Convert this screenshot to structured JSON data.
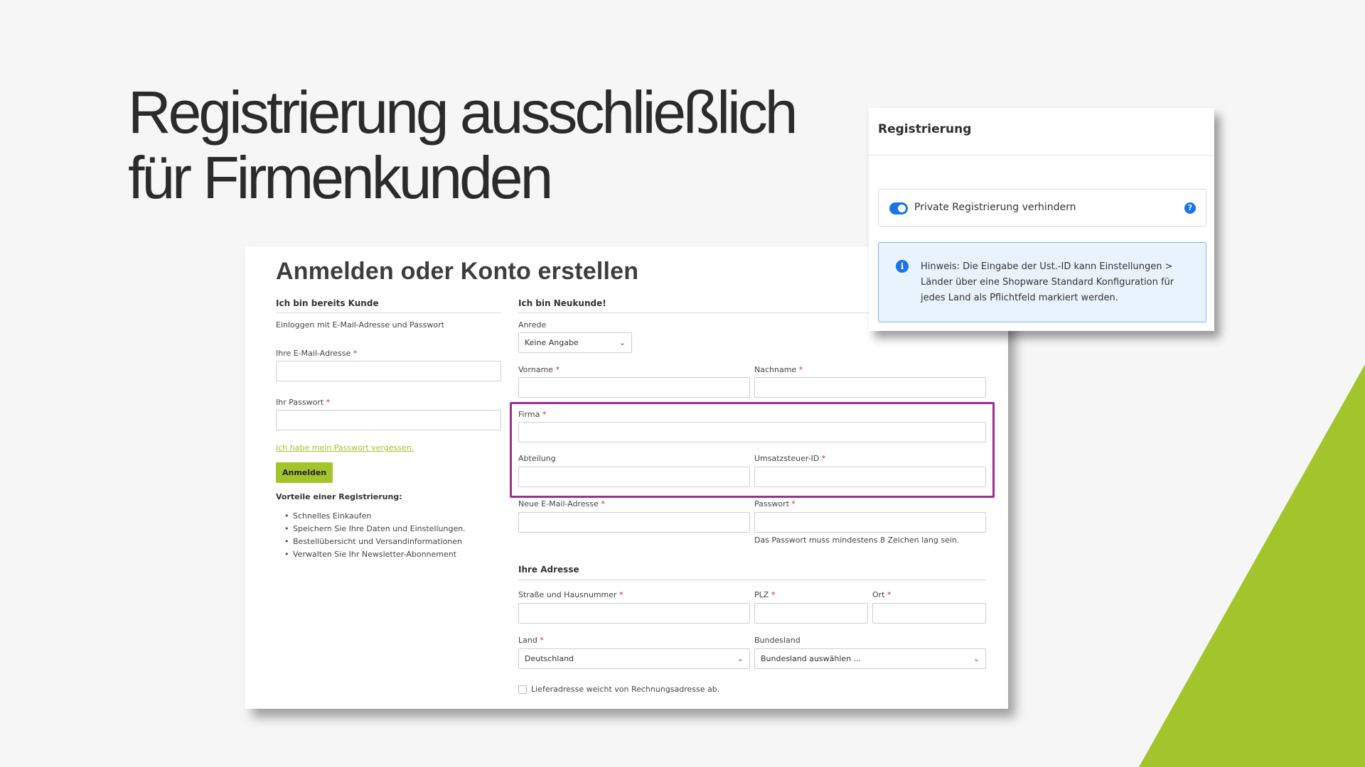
{
  "slide": {
    "title_line1": "Registrierung ausschließlich",
    "title_line2": "für Firmenkunden",
    "accent_color": "#a3c42b",
    "highlight_color": "#9c2f8e"
  },
  "storefront": {
    "heading": "Anmelden oder Konto erstellen",
    "login": {
      "section_title": "Ich bin bereits Kunde",
      "intro": "Einloggen mit E-Mail-Adresse und Passwort",
      "email_label": "Ihre E-Mail-Adresse",
      "password_label": "Ihr Passwort",
      "required_mark": "*",
      "forgot_link": "Ich habe mein Passwort vergessen.",
      "login_button": "Anmelden",
      "benefits_title": "Vorteile einer Registrierung:",
      "benefits": [
        "Schnelles Einkaufen",
        "Speichern Sie Ihre Daten und Einstellungen.",
        "Bestellübersicht und Versandinformationen",
        "Verwalten Sie Ihr Newsletter-Abonnement"
      ]
    },
    "register": {
      "section_title": "Ich bin Neukunde!",
      "salutation_label": "Anrede",
      "salutation_value": "Keine Angabe",
      "firstname_label": "Vorname",
      "lastname_label": "Nachname",
      "company_label": "Firma",
      "department_label": "Abteilung",
      "vat_label": "Umsatzsteuer-ID",
      "new_email_label": "Neue E-Mail-Adresse",
      "password_label": "Passwort",
      "password_hint": "Das Passwort muss mindestens 8 Zeichen lang sein.",
      "address_title": "Ihre Adresse",
      "street_label": "Straße und Hausnummer",
      "zip_label": "PLZ",
      "city_label": "Ort",
      "country_label": "Land",
      "country_value": "Deutschland",
      "state_label": "Bundesland",
      "state_value": "Bundesland auswählen ...",
      "shipping_checkbox_label": "Lieferadresse weicht von Rechnungsadresse ab.",
      "shipping_checkbox_checked": false
    }
  },
  "admin": {
    "title": "Registrierung",
    "toggle_label": "Private Registrierung verhindern",
    "toggle_on": true,
    "help_icon": "?",
    "info_icon": "i",
    "info_text": "Hinweis: Die Eingabe der Ust.-ID kann Einstellungen > Länder über eine Shopware Standard Konfiguration für jedes Land als Pflichtfeld markiert werden."
  }
}
